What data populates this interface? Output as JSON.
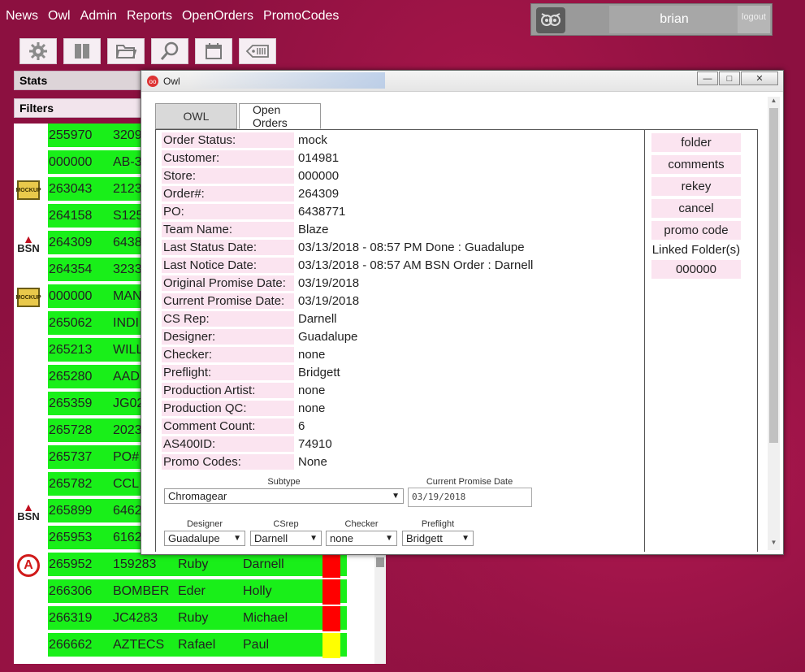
{
  "nav": {
    "items": [
      "News",
      "Owl",
      "Admin",
      "Reports",
      "OpenOrders",
      "PromoCodes"
    ]
  },
  "user": {
    "name": "brian",
    "logout_label": "logout"
  },
  "toolbar": {
    "icons": [
      "gear-icon",
      "columns-icon",
      "folder-icon",
      "search-icon",
      "calendar-icon",
      "tag-icon"
    ]
  },
  "left": {
    "stats_label": "Stats",
    "filters_label": "Filters",
    "rows": [
      {
        "order": "255970",
        "po": "3209",
        "icon": "",
        "a": "",
        "b": "",
        "status": ""
      },
      {
        "order": "000000",
        "po": "AB-3",
        "icon": "",
        "a": "",
        "b": "",
        "status": ""
      },
      {
        "order": "263043",
        "po": "2123",
        "icon": "mockup",
        "a": "",
        "b": "",
        "status": ""
      },
      {
        "order": "264158",
        "po": "S125",
        "icon": "",
        "a": "",
        "b": "",
        "status": ""
      },
      {
        "order": "264309",
        "po": "6438",
        "icon": "bsn",
        "a": "",
        "b": "",
        "status": ""
      },
      {
        "order": "264354",
        "po": "3233",
        "icon": "",
        "a": "",
        "b": "",
        "status": ""
      },
      {
        "order": "000000",
        "po": "MAN",
        "icon": "mockup",
        "a": "",
        "b": "",
        "status": ""
      },
      {
        "order": "265062",
        "po": "INDI",
        "icon": "",
        "a": "",
        "b": "",
        "status": ""
      },
      {
        "order": "265213",
        "po": "WILL",
        "icon": "",
        "a": "",
        "b": "",
        "status": ""
      },
      {
        "order": "265280",
        "po": "AAD",
        "icon": "",
        "a": "",
        "b": "",
        "status": ""
      },
      {
        "order": "265359",
        "po": "JG02",
        "icon": "",
        "a": "",
        "b": "",
        "status": ""
      },
      {
        "order": "265728",
        "po": "2023",
        "icon": "",
        "a": "",
        "b": "",
        "status": ""
      },
      {
        "order": "265737",
        "po": "PO#",
        "icon": "",
        "a": "",
        "b": "",
        "status": ""
      },
      {
        "order": "265782",
        "po": "CCL",
        "icon": "",
        "a": "",
        "b": "",
        "status": ""
      },
      {
        "order": "265899",
        "po": "6462",
        "icon": "bsn",
        "a": "",
        "b": "",
        "status": ""
      },
      {
        "order": "265953",
        "po": "6162",
        "icon": "",
        "a": "",
        "b": "",
        "status": ""
      },
      {
        "order": "265952",
        "po": "159283",
        "icon": "a-logo",
        "a": "Ruby",
        "b": "Darnell",
        "status": "#ff0000"
      },
      {
        "order": "266306",
        "po": "BOMBER",
        "icon": "",
        "a": "Eder",
        "b": "Holly",
        "status": "#ff0000"
      },
      {
        "order": "266319",
        "po": "JC4283",
        "icon": "",
        "a": "Ruby",
        "b": "Michael",
        "status": "#ff0000"
      },
      {
        "order": "266662",
        "po": "AZTECS",
        "icon": "",
        "a": "Rafael",
        "b": "Paul",
        "status": "#ffff00"
      }
    ]
  },
  "dialog": {
    "title": "Owl",
    "min_glyph": "—",
    "max_glyph": "□",
    "close_glyph": "✕",
    "tabs": [
      "OWL",
      "Open Orders"
    ],
    "fields": [
      {
        "label": "Order Status:",
        "value": "mock"
      },
      {
        "label": "Customer:",
        "value": "014981"
      },
      {
        "label": "Store:",
        "value": "000000"
      },
      {
        "label": "Order#:",
        "value": "264309"
      },
      {
        "label": "PO:",
        "value": "6438771"
      },
      {
        "label": "Team Name:",
        "value": "Blaze"
      },
      {
        "label": "Last Status Date:",
        "value": "03/13/2018 - 08:57 PM Done : Guadalupe"
      },
      {
        "label": "Last Notice Date:",
        "value": "03/13/2018 - 08:57 AM BSN Order : Darnell"
      },
      {
        "label": "Original Promise Date:",
        "value": "03/19/2018"
      },
      {
        "label": "Current Promise Date:",
        "value": "03/19/2018"
      },
      {
        "label": "CS Rep:",
        "value": "Darnell"
      },
      {
        "label": "Designer:",
        "value": "Guadalupe"
      },
      {
        "label": "Checker:",
        "value": "none"
      },
      {
        "label": "Preflight:",
        "value": "Bridgett"
      },
      {
        "label": "Production Artist:",
        "value": "none"
      },
      {
        "label": "Production QC:",
        "value": "none"
      },
      {
        "label": "Comment Count:",
        "value": "6"
      },
      {
        "label": "AS400ID:",
        "value": "74910"
      },
      {
        "label": "Promo Codes:",
        "value": "None"
      }
    ],
    "actions": [
      "folder",
      "comments",
      "rekey",
      "cancel",
      "promo code"
    ],
    "linked_label": "Linked Folder(s)",
    "linked_folder": "000000",
    "form": {
      "subtype_label": "Subtype",
      "subtype_value": "Chromagear",
      "promise_label": "Current Promise Date",
      "promise_value": "03/19/2018",
      "designer_label": "Designer",
      "designer_value": "Guadalupe",
      "csrep_label": "CSrep",
      "csrep_value": "Darnell",
      "checker_label": "Checker",
      "checker_value": "none",
      "preflight_label": "Preflight",
      "preflight_value": "Bridgett"
    }
  }
}
